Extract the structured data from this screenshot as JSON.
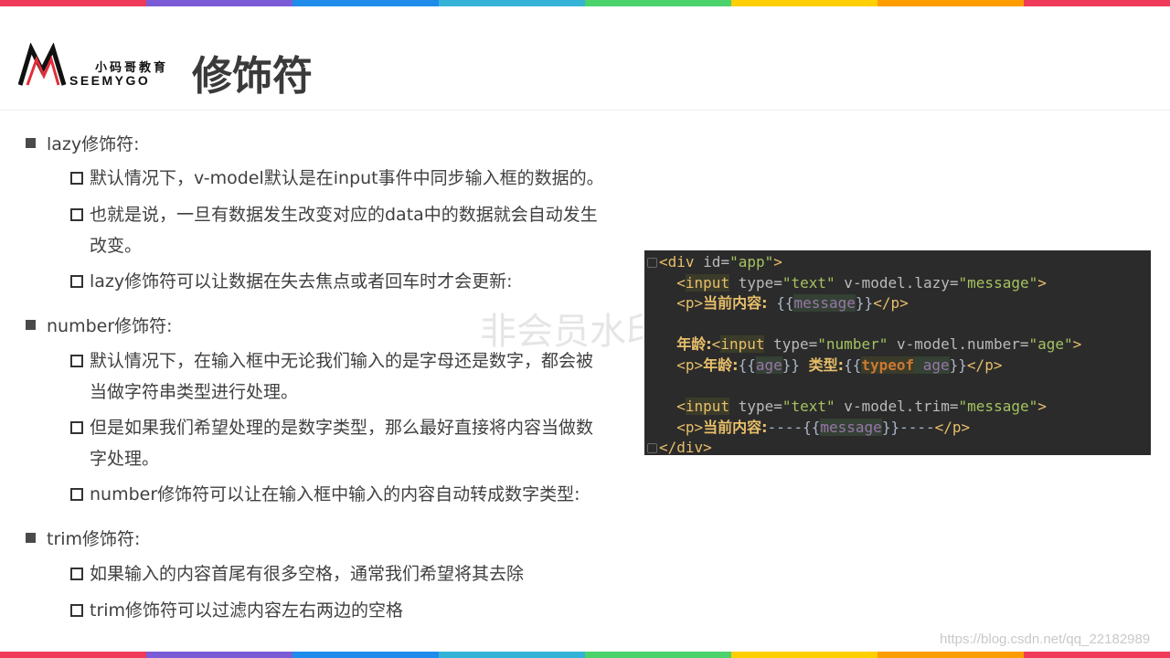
{
  "colors": {
    "stripe": [
      "#ef3b59",
      "#7b5bd6",
      "#1f8cec",
      "#35b3d7",
      "#4cd26b",
      "#ffcf00",
      "#ff9d00",
      "#ef3b59"
    ],
    "code_bg": "#2b2b2b"
  },
  "logo": {
    "cn": "小码哥教育",
    "en": "SEEMYGO"
  },
  "page_title": "修饰符",
  "sections": [
    {
      "title": "lazy修饰符:",
      "items": [
        {
          "lines": [
            "默认情况下，v-model默认是在input事件中同步输入框的数据的。"
          ]
        },
        {
          "lines": [
            "也就是说，一旦有数据发生改变对应的data中的数据就会自动发生",
            "改变。"
          ]
        },
        {
          "lines": [
            "lazy修饰符可以让数据在失去焦点或者回车时才会更新:"
          ]
        }
      ]
    },
    {
      "title": "number修饰符:",
      "items": [
        {
          "lines": [
            "默认情况下，在输入框中无论我们输入的是字母还是数字，都会被",
            "当做字符串类型进行处理。"
          ]
        },
        {
          "lines": [
            "但是如果我们希望处理的是数字类型，那么最好直接将内容当做数",
            "字处理。"
          ]
        },
        {
          "lines": [
            "number修饰符可以让在输入框中输入的内容自动转成数字类型:"
          ]
        }
      ]
    },
    {
      "title": "trim修饰符:",
      "items": [
        {
          "lines": [
            "如果输入的内容首尾有很多空格，通常我们希望将其去除"
          ]
        },
        {
          "lines": [
            "trim修饰符可以过滤内容左右两边的空格"
          ]
        }
      ]
    }
  ],
  "code": {
    "l1": {
      "open": "<div ",
      "attr": "id=",
      "val": "\"app\"",
      "close": ">"
    },
    "l2": {
      "lt": "<",
      "tag": "input",
      "a1": " type=",
      "v1": "\"text\"",
      "a2": " v-model.lazy=",
      "v2": "\"message\"",
      "gt": ">"
    },
    "l3": {
      "open": "<p>",
      "label": "当前内容:",
      "pre": " {{",
      "var": "message",
      "post": "}}",
      "close": "</p>"
    },
    "l5": {
      "label": "年龄:",
      "lt": "<",
      "tag": "input",
      "a1": " type=",
      "v1": "\"number\"",
      "a2": " v-model.number=",
      "v2": "\"age\"",
      "gt": ">"
    },
    "l6": {
      "open": "<p>",
      "label": "年龄:",
      "pre": "{{",
      "var": "age",
      "post": "}} ",
      "label2": "类型:",
      "pre2": "{{",
      "kw": "typeof",
      "var2": " age",
      "post2": "}}",
      "close": "</p>"
    },
    "l8": {
      "lt": "<",
      "tag": "input",
      "a1": " type=",
      "v1": "\"text\"",
      "a2": " v-model.trim=",
      "v2": "\"message\"",
      "gt": ">"
    },
    "l9": {
      "open": "<p>",
      "label": "当前内容:",
      "pre": "----{{",
      "var": "message",
      "post": "}}----",
      "close": "</p>"
    },
    "l10": {
      "close": "</div>"
    }
  },
  "watermark": {
    "center": "非会员水印",
    "url": "https://blog.csdn.net/qq_22182989"
  }
}
